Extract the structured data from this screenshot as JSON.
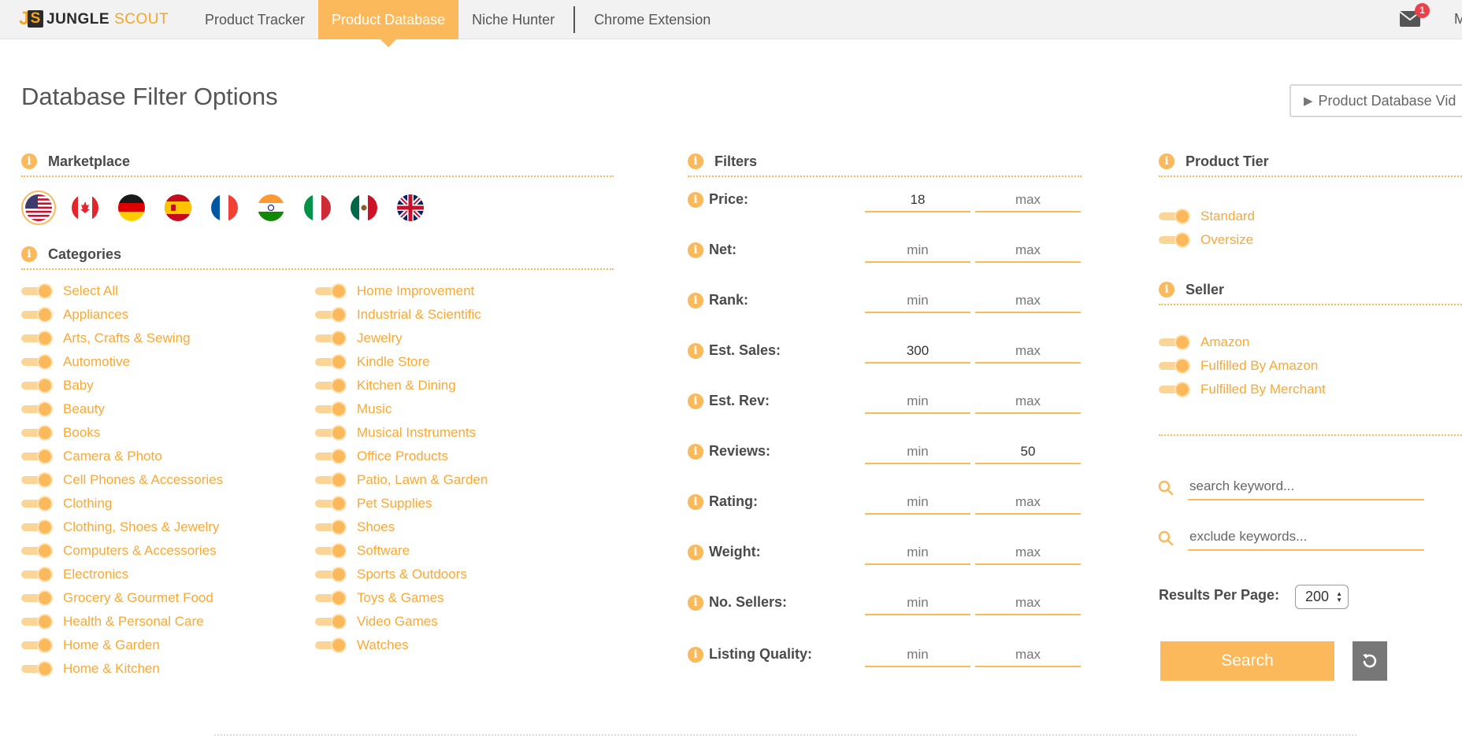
{
  "app": {
    "logo_js": "JS",
    "logo_word1": "JUNGLE",
    "logo_word2": "SCOUT"
  },
  "nav": {
    "items": [
      {
        "label": "Product Tracker",
        "active": false
      },
      {
        "label": "Product Database",
        "active": true
      },
      {
        "label": "Niche Hunter",
        "active": false
      },
      {
        "label": "Chrome Extension",
        "active": false
      }
    ],
    "mail_badge": "1",
    "user_truncated": "M"
  },
  "page": {
    "title": "Database Filter Options",
    "video_button": "Product Database Vid"
  },
  "marketplace": {
    "title": "Marketplace",
    "flags": [
      {
        "name": "us",
        "selected": true
      },
      {
        "name": "ca",
        "selected": false
      },
      {
        "name": "de",
        "selected": false
      },
      {
        "name": "es",
        "selected": false
      },
      {
        "name": "fr",
        "selected": false
      },
      {
        "name": "in",
        "selected": false
      },
      {
        "name": "it",
        "selected": false
      },
      {
        "name": "mx",
        "selected": false
      },
      {
        "name": "uk",
        "selected": false
      }
    ]
  },
  "categories": {
    "title": "Categories",
    "col1": [
      "Select All",
      "Appliances",
      "Arts, Crafts & Sewing",
      "Automotive",
      "Baby",
      "Beauty",
      "Books",
      "Camera & Photo",
      "Cell Phones & Accessories",
      "Clothing",
      "Clothing, Shoes & Jewelry",
      "Computers & Accessories",
      "Electronics",
      "Grocery & Gourmet Food",
      "Health & Personal Care",
      "Home & Garden",
      "Home & Kitchen"
    ],
    "col2": [
      "Home Improvement",
      "Industrial & Scientific",
      "Jewelry",
      "Kindle Store",
      "Kitchen & Dining",
      "Music",
      "Musical Instruments",
      "Office Products",
      "Patio, Lawn & Garden",
      "Pet Supplies",
      "Shoes",
      "Software",
      "Sports & Outdoors",
      "Toys & Games",
      "Video Games",
      "Watches"
    ]
  },
  "filters": {
    "title": "Filters",
    "min_placeholder": "min",
    "max_placeholder": "max",
    "rows": [
      {
        "label": "Price:",
        "min": "18",
        "max": ""
      },
      {
        "label": "Net:",
        "min": "",
        "max": ""
      },
      {
        "label": "Rank:",
        "min": "",
        "max": ""
      },
      {
        "label": "Est. Sales:",
        "min": "300",
        "max": ""
      },
      {
        "label": "Est. Rev:",
        "min": "",
        "max": ""
      },
      {
        "label": "Reviews:",
        "min": "",
        "max": "50"
      },
      {
        "label": "Rating:",
        "min": "",
        "max": ""
      },
      {
        "label": "Weight:",
        "min": "",
        "max": ""
      },
      {
        "label": "No. Sellers:",
        "min": "",
        "max": ""
      },
      {
        "label": "Listing Quality:",
        "min": "",
        "max": ""
      }
    ]
  },
  "product_tier": {
    "title": "Product Tier",
    "options": [
      "Standard",
      "Oversize"
    ]
  },
  "seller": {
    "title": "Seller",
    "options": [
      "Amazon",
      "Fulfilled By Amazon",
      "Fulfilled By Merchant"
    ]
  },
  "keywords": {
    "search_placeholder": "search keyword...",
    "exclude_placeholder": "exclude keywords..."
  },
  "results": {
    "label": "Results Per Page:",
    "value": "200"
  },
  "actions": {
    "search_label": "Search"
  },
  "colors": {
    "accent": "#fbb95b",
    "link": "#fba834",
    "text": "#4a4a4a",
    "badge": "#e9424d"
  },
  "icons": {
    "info": "info-icon",
    "search": "search-icon",
    "mail": "mail-icon",
    "reset": "reset-icon",
    "play": "play-icon"
  }
}
